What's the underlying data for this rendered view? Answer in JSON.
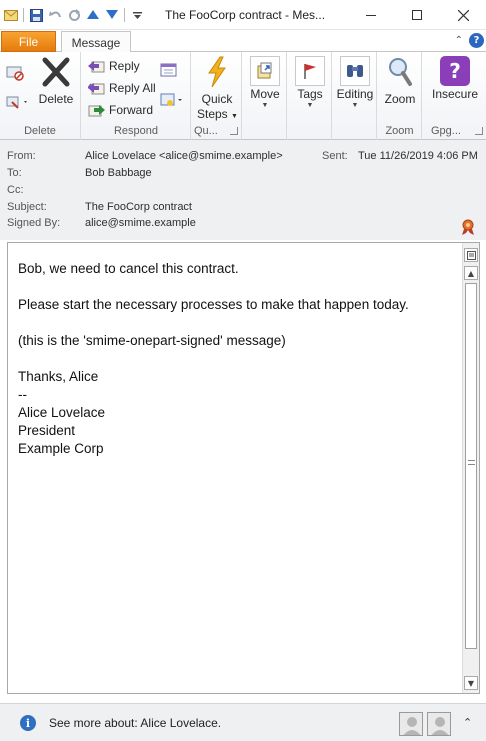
{
  "window": {
    "title": "The FooCorp contract  -  Mes..."
  },
  "tabs": {
    "file_label": "File",
    "message_label": "Message"
  },
  "ribbon": {
    "delete_label": "Delete",
    "delete_group": "Delete",
    "reply_label": "Reply",
    "reply_all_label": "Reply All",
    "forward_label": "Forward",
    "respond_group": "Respond",
    "quick_steps_line1": "Quick",
    "quick_steps_line2": "Steps",
    "quick_steps_group": "Qu...",
    "move_label": "Move",
    "tags_label": "Tags",
    "editing_label": "Editing",
    "zoom_label": "Zoom",
    "zoom_group": "Zoom",
    "insecure_label": "Insecure",
    "gpg_group": "Gpg..."
  },
  "header": {
    "from_label": "From:",
    "from_value": "Alice Lovelace <alice@smime.example>",
    "sent_label": "Sent:",
    "sent_value": "Tue 11/26/2019 4:06 PM",
    "to_label": "To:",
    "to_value": "Bob Babbage",
    "cc_label": "Cc:",
    "cc_value": "",
    "subject_label": "Subject:",
    "subject_value": "The FooCorp contract",
    "signed_label": "Signed By:",
    "signed_value": "alice@smime.example"
  },
  "body": {
    "line1": "Bob, we need to cancel this contract.",
    "line2": "Please start the necessary processes to make that happen today.",
    "line3": "(this is the 'smime-onepart-signed' message)",
    "line4": "Thanks, Alice",
    "line5": "--",
    "line6": "Alice Lovelace",
    "line7": "President",
    "line8": "Example Corp"
  },
  "footer": {
    "see_more": "See more about: Alice Lovelace."
  },
  "colors": {
    "file_tab": "#f38f1e",
    "insecure_icon": "#8a3fb8",
    "quick_steps_icon": "#f2b01e",
    "info_icon": "#2f6fbf"
  }
}
